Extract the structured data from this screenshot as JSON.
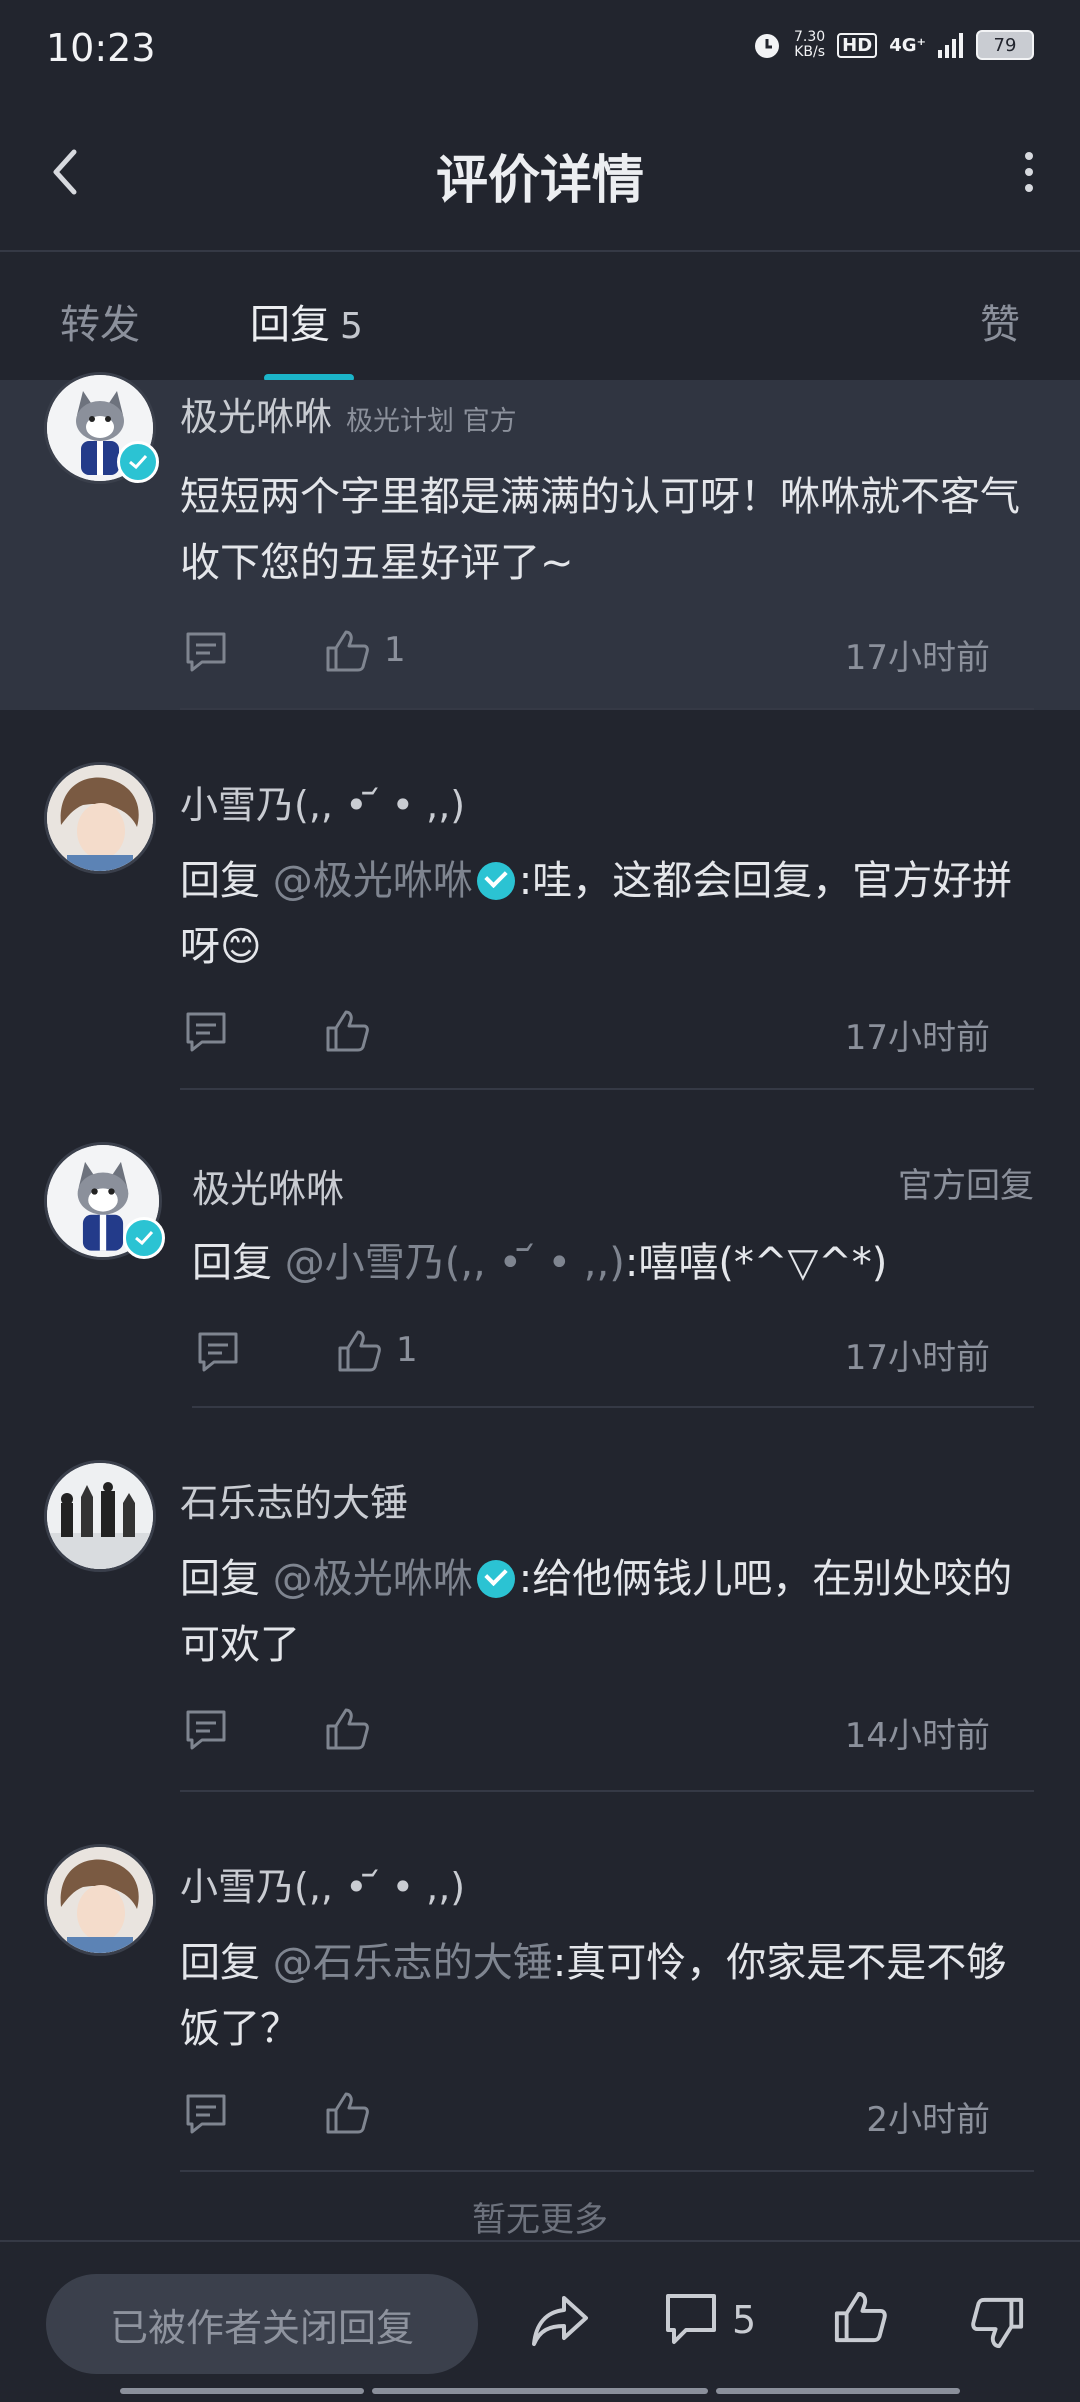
{
  "status_bar": {
    "time": "10:23",
    "speed": "7.30",
    "speed_unit": "KB/s",
    "hd": "HD",
    "network": "4G⁺",
    "battery": "79"
  },
  "header": {
    "title": "评价详情"
  },
  "tabs": {
    "repost": "转发",
    "reply": "回复",
    "reply_count": "5",
    "like": "赞"
  },
  "comments": [
    {
      "name": "极光咻咻",
      "meta": "极光计划 官方",
      "text": "短短两个字里都是满满的认可呀！咻咻就不客气收下您的五星好评了~",
      "like_count": "1",
      "time": "17小时前"
    },
    {
      "name": "小雪乃(,, • ᷄ • ,,)",
      "prefix": "回复 ",
      "mention": "@极光咻咻",
      "text": ":哇，这都会回复，官方好拼呀😊",
      "like_count": "",
      "time": "17小时前"
    },
    {
      "name": "极光咻咻",
      "tag": "官方回复",
      "prefix": "回复 ",
      "mention": "@小雪乃(,, • ᷄ • ,,)",
      "text": ":嘻嘻(*^▽^*)",
      "like_count": "1",
      "time": "17小时前"
    },
    {
      "name": "石乐志的大锤",
      "prefix": "回复 ",
      "mention": "@极光咻咻",
      "text": ":给他俩钱儿吧，在别处咬的可欢了",
      "like_count": "",
      "time": "14小时前"
    },
    {
      "name": "小雪乃(,, • ᷄ • ,,)",
      "prefix": "回复 ",
      "mention": "@石乐志的大锤",
      "text": ":真可怜，你家是不是不够饭了？",
      "like_count": "",
      "time": "2小时前"
    }
  ],
  "no_more": "暂无更多",
  "bottom_bar": {
    "closed_text": "已被作者关闭回复",
    "comment_count": "5"
  },
  "colors": {
    "background": "#22252e",
    "highlight": "#303541",
    "accent": "#1bb5c9",
    "muted": "#8b909b"
  }
}
